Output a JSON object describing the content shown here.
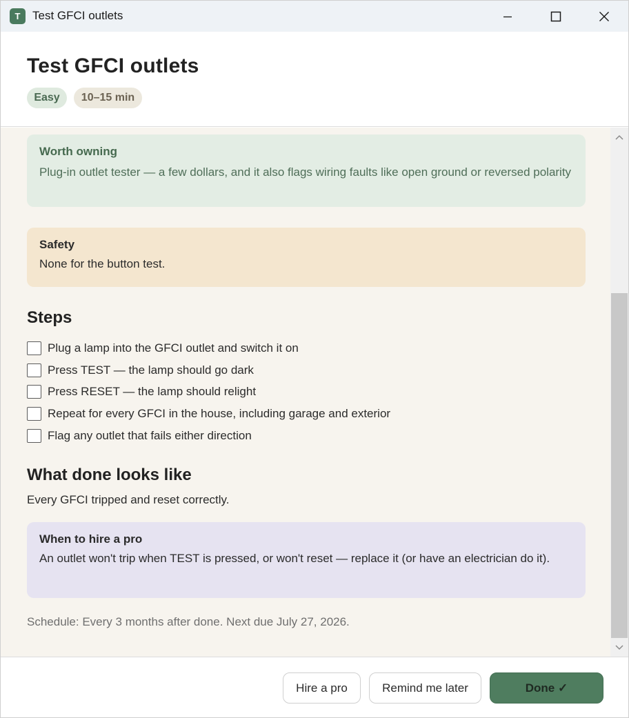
{
  "window": {
    "app_icon_letter": "T",
    "title": "Test GFCI outlets"
  },
  "header": {
    "title": "Test GFCI outlets",
    "difficulty": "Easy",
    "duration": "10–15 min"
  },
  "worth_owning": {
    "title": "Worth owning",
    "body": "Plug-in outlet tester — a few dollars, and it also flags wiring faults like open ground or reversed polarity"
  },
  "safety": {
    "title": "Safety",
    "body": "None for the button test."
  },
  "steps": {
    "title": "Steps",
    "items": [
      {
        "label": "Plug a lamp into the GFCI outlet and switch it on",
        "checked": false
      },
      {
        "label": "Press TEST — the lamp should go dark",
        "checked": false
      },
      {
        "label": "Press RESET — the lamp should relight",
        "checked": false
      },
      {
        "label": "Repeat for every GFCI in the house, including garage and exterior",
        "checked": false
      },
      {
        "label": "Flag any outlet that fails either direction",
        "checked": false
      }
    ]
  },
  "done_looks_like": {
    "title": "What done looks like",
    "body": "Every GFCI tripped and reset correctly."
  },
  "hire_pro": {
    "title": "When to hire a pro",
    "body": "An outlet won't trip when TEST is pressed, or won't reset — replace it (or have an electrician do it)."
  },
  "schedule": "Schedule: Every 3 months after done. Next due July 27, 2026.",
  "footer": {
    "hire_label": "Hire a pro",
    "remind_label": "Remind me later",
    "done_label": "Done ✓"
  },
  "colors": {
    "accent": "#4f7d5f",
    "worth_bg": "#e3ede4",
    "safety_bg": "#f4e6cf",
    "pro_bg": "#e6e3f1",
    "content_bg": "#f7f4ee"
  }
}
